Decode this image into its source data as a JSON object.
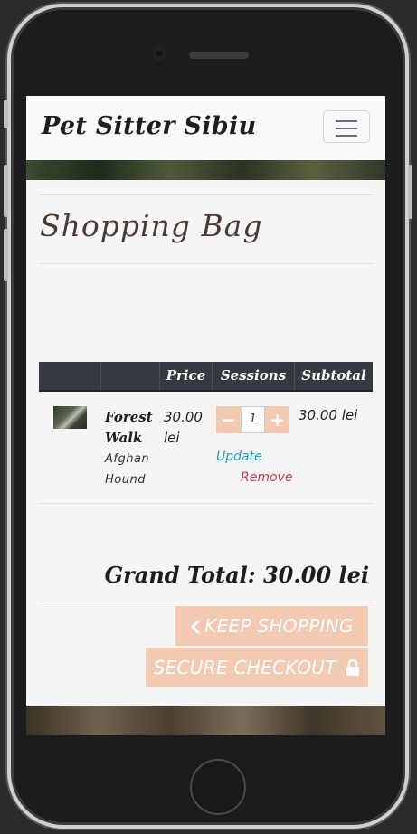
{
  "navbar": {
    "brand": "Pet Sitter Sibiu"
  },
  "page": {
    "title": "Shopping Bag"
  },
  "table": {
    "headers": [
      "",
      "",
      "Price",
      "Sessions",
      "Subtotal"
    ],
    "rows": [
      {
        "name": "Forest Walk",
        "breed": "Afghan Hound",
        "price": "30.00 lei",
        "quantity": "1",
        "subtotal": "30.00 lei",
        "update_label": "Update",
        "remove_label": "Remove",
        "minus_label": "−",
        "plus_label": "+"
      }
    ]
  },
  "totals": {
    "grand_total": "Grand Total: 30.00 lei"
  },
  "buttons": {
    "keep_shopping": "KEEP SHOPPING",
    "secure_checkout": "SECURE CHECKOUT"
  },
  "icons": {
    "keep_shopping": "chevron-left-icon",
    "secure_checkout": "lock-icon"
  },
  "colors": {
    "accent_button": "#f2c9b1",
    "table_header": "#343a40",
    "update_link": "#17a2b8",
    "remove_link": "#dc3545"
  }
}
